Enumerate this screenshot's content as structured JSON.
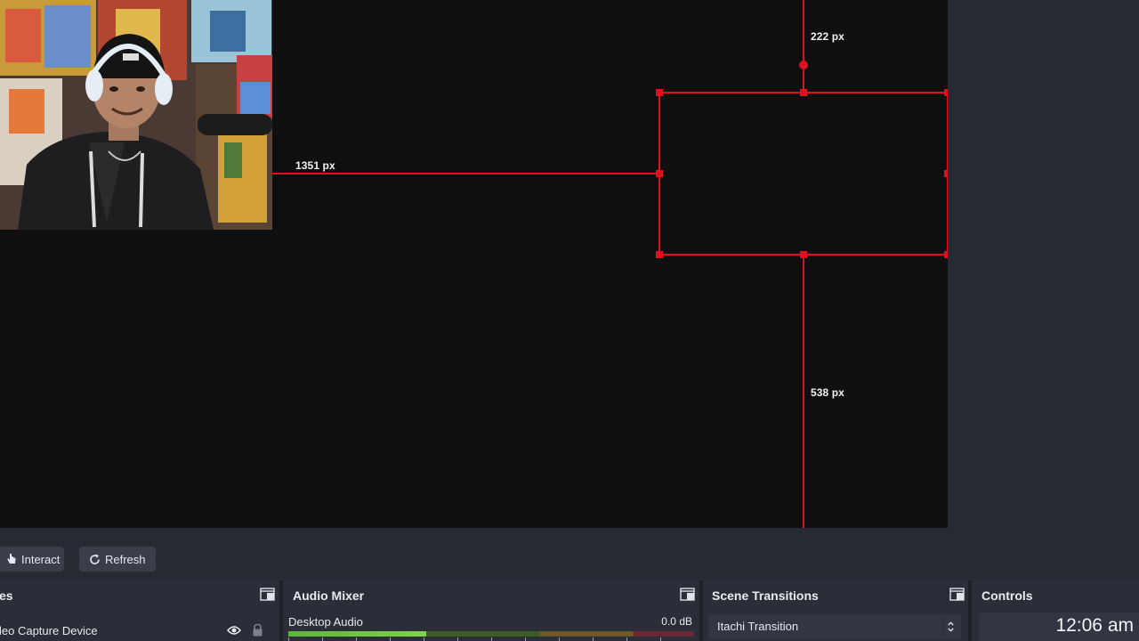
{
  "preview": {
    "guides": {
      "top_distance": "222 px",
      "left_distance": "1351 px",
      "bottom_distance": "538 px"
    }
  },
  "toolbar": {
    "interact_label": "Interact",
    "refresh_label": "Refresh"
  },
  "sources_dock": {
    "title": "es",
    "item_label": "leo Capture Device"
  },
  "audio_mixer": {
    "title": "Audio Mixer",
    "channel_name": "Desktop Audio",
    "channel_db": "0.0 dB",
    "level_fraction": 0.34
  },
  "scene_transitions": {
    "title": "Scene Transitions",
    "selected": "Itachi Transition"
  },
  "controls": {
    "title": "Controls",
    "clock": "12:06 am"
  },
  "colors": {
    "guide_red": "#e0101e",
    "canvas": "#0f0f10",
    "panel": "#2b2e38"
  }
}
